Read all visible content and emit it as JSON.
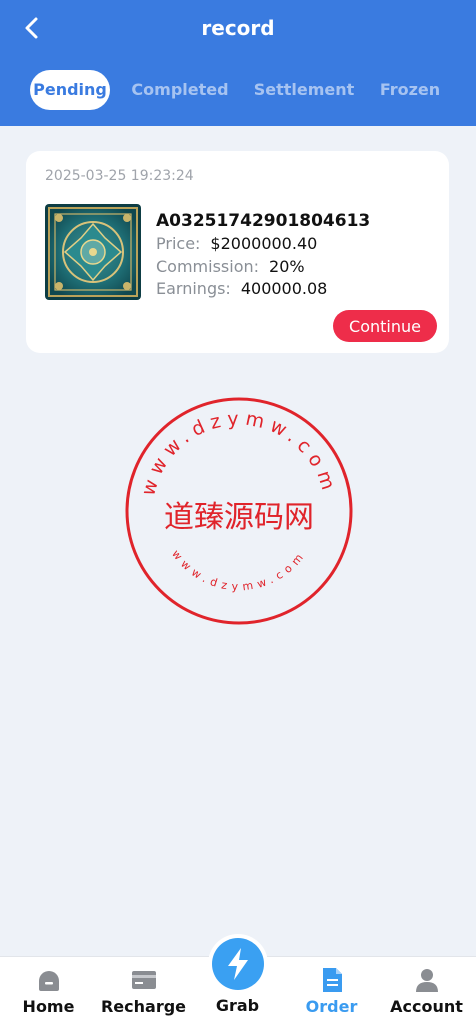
{
  "header": {
    "title": "record",
    "back_icon": "chevron-left-icon"
  },
  "tabs": [
    {
      "label": "Pending",
      "active": true
    },
    {
      "label": "Completed",
      "active": false
    },
    {
      "label": "Settlement",
      "active": false
    },
    {
      "label": "Frozen",
      "active": false
    }
  ],
  "order": {
    "timestamp": "2025-03-25 19:23:24",
    "id": "A03251742901804613",
    "price_label": "Price:",
    "price_value": "$2000000.40",
    "commission_label": "Commission:",
    "commission_value": "20%",
    "earnings_label": "Earnings:",
    "earnings_value": "400000.08",
    "continue_label": "Continue",
    "thumbnail": "carpet-image"
  },
  "watermark": {
    "text_center": "道臻源码网",
    "text_ring": "www.dzymw.com",
    "color": "#e0242b"
  },
  "nav": [
    {
      "label": "Home",
      "icon": "home-icon"
    },
    {
      "label": "Recharge",
      "icon": "card-icon"
    },
    {
      "label": "Grab",
      "icon": "lightning-icon"
    },
    {
      "label": "Order",
      "icon": "document-icon",
      "active": true
    },
    {
      "label": "Account",
      "icon": "user-icon"
    }
  ],
  "colors": {
    "primary": "#3a7be0",
    "accent": "#ee2d4a",
    "nav_active": "#3a9bf0"
  }
}
